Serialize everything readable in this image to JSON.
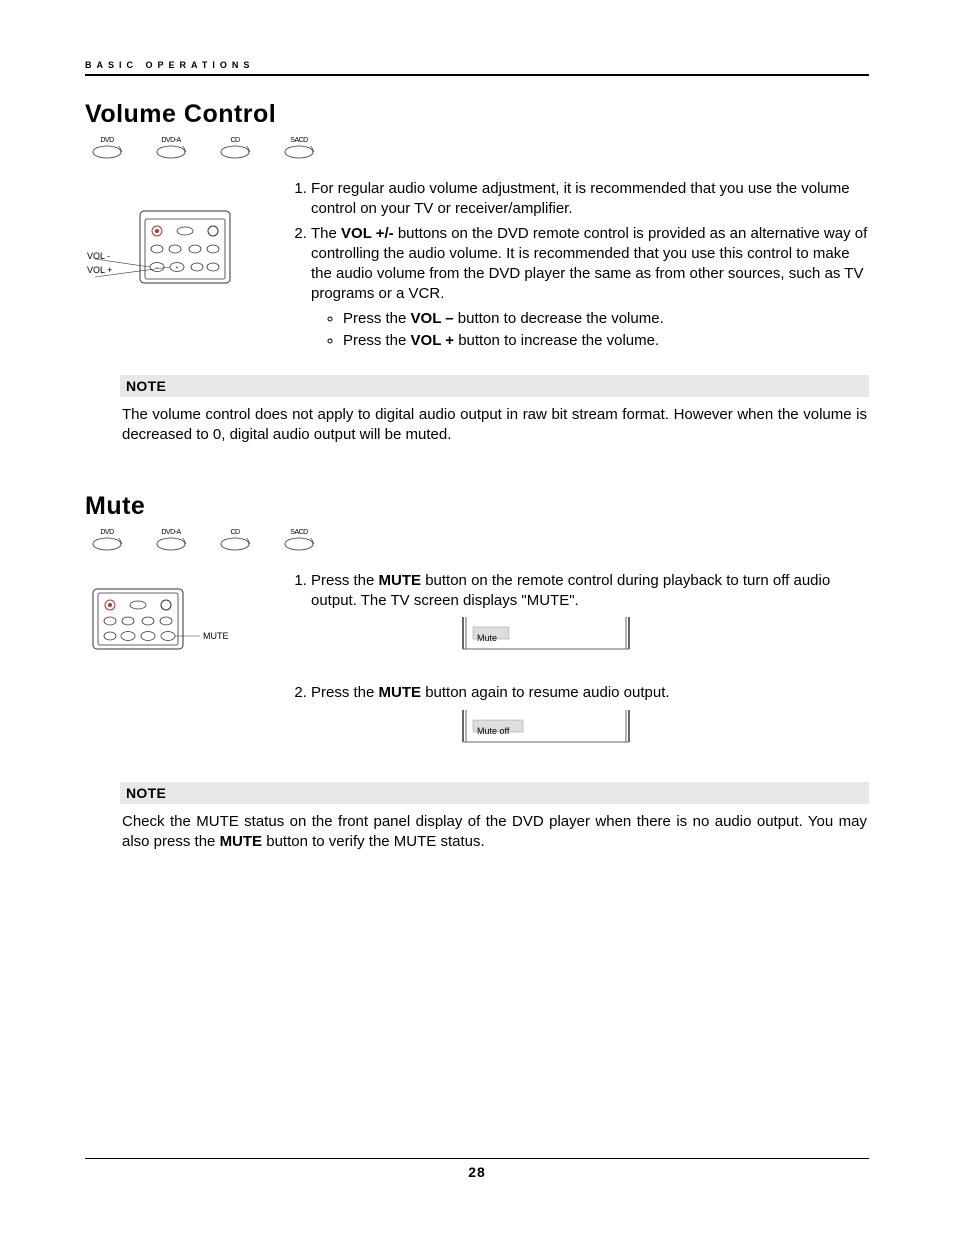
{
  "header": {
    "breadcrumb": "BASIC OPERATIONS"
  },
  "page_number": "28",
  "disc_types": [
    "DVD",
    "DVD-A",
    "CD",
    "SACD"
  ],
  "section1": {
    "title": "Volume Control",
    "remote_labels": {
      "vol_minus": "VOL -",
      "vol_plus": "VOL +"
    },
    "items": {
      "1": "For regular audio volume adjustment, it is recommended that you use the volume control on your TV or receiver/amplifier.",
      "2a": "The ",
      "2b_bold": "VOL +/-",
      "2c": " buttons on the DVD remote control is provided as an alternative way of controlling the audio volume.  It is recommended that you use this control to make the audio volume from the DVD player the same as from other sources, such as TV programs or a VCR.",
      "bullet1a": "Press the ",
      "bullet1b_bold": "VOL –",
      "bullet1c": " button to decrease the volume.",
      "bullet2a": "Press the ",
      "bullet2b_bold": "VOL +",
      "bullet2c": " button to increase the volume."
    },
    "note": {
      "title": "NOTE",
      "body": "The volume control does not apply to digital audio output in raw bit stream format.  However when the volume is decreased to 0, digital audio output will be muted."
    }
  },
  "section2": {
    "title": "Mute",
    "remote_label": "MUTE",
    "items": {
      "1a": "Press the ",
      "1b_bold": "MUTE",
      "1c": " button on the remote control during playback to turn off audio output.  The TV screen displays \"MUTE\".",
      "2a": "Press the ",
      "2b_bold": "MUTE",
      "2c": " button again to resume audio output."
    },
    "osd1": "Mute",
    "osd2": "Mute off",
    "note": {
      "title": "NOTE",
      "body_a": "Check the MUTE status on the front panel display of the DVD player when there is no audio output.  You may also press the ",
      "body_bold": "MUTE",
      "body_b": " button to verify the MUTE status."
    }
  }
}
